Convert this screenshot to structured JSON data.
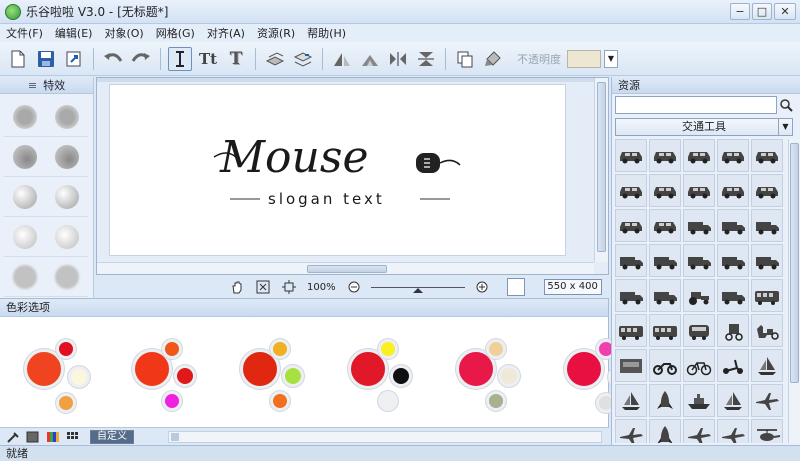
{
  "window": {
    "title": "乐谷啦啦 V3.0 - [无标题*]",
    "min": "−",
    "max": "□",
    "close": "✕"
  },
  "menu": [
    "文件(F)",
    "编辑(E)",
    "对象(O)",
    "网格(G)",
    "对齐(A)",
    "资源(R)",
    "帮助(H)"
  ],
  "toolbar": {
    "opacity_label": "不透明度",
    "opacity_color": "#ece6d3"
  },
  "effects": {
    "title": "特效"
  },
  "canvas": {
    "logo_text": "Mouse",
    "slogan": "slogan text",
    "zoom": "100%",
    "size": "550 x 400"
  },
  "colors": {
    "title": "色彩选项",
    "custom_label": "自定义",
    "schemes": [
      {
        "main": "#f04420",
        "c1": "#e01020",
        "c2": "#faf6e0",
        "c3": "#f0a040"
      },
      {
        "main": "#f03818",
        "c1": "#f05818",
        "c2": "#e01818",
        "c3": "#f020e0"
      },
      {
        "main": "#e02810",
        "c1": "#f0b020",
        "c2": "#a8e040",
        "c3": "#f07020"
      },
      {
        "main": "#e01828",
        "c1": "#f8f020",
        "c2": "#101010",
        "c3": "#f0f0f0"
      },
      {
        "main": "#e81848",
        "c1": "#f0d098",
        "c2": "#f0e8d8",
        "c3": "#a8b090"
      },
      {
        "main": "#e81040",
        "c1": "#f040b0",
        "c2": "#f0f0f0",
        "c3": "#e0e0e0"
      }
    ]
  },
  "resources": {
    "title": "资源",
    "search_placeholder": "",
    "category": "交通工具",
    "icons": [
      "car-icon",
      "car-icon",
      "car-icon",
      "car-icon",
      "car-icon",
      "car-icon",
      "car-icon",
      "car-icon",
      "car-icon",
      "car-icon",
      "car-icon",
      "car-icon",
      "truck-icon",
      "truck-icon",
      "truck-icon",
      "truck-icon",
      "truck-icon",
      "truck-icon",
      "truck-icon",
      "truck-icon",
      "truck-icon",
      "truck-icon",
      "tractor-icon",
      "truck-icon",
      "bus-icon",
      "bus-icon",
      "bus-icon",
      "train-icon",
      "carriage-icon",
      "horse-cart-icon",
      "tram-icon",
      "motorcycle-icon",
      "bicycle-icon",
      "scooter-icon",
      "sailboat-icon",
      "sailboat-icon",
      "rocket-icon",
      "ship-icon",
      "sailboat-icon",
      "airplane-icon",
      "airplane-icon",
      "rocket-icon",
      "airplane-icon",
      "airplane-icon",
      "helicopter-icon"
    ]
  },
  "status": {
    "text": "就绪"
  }
}
